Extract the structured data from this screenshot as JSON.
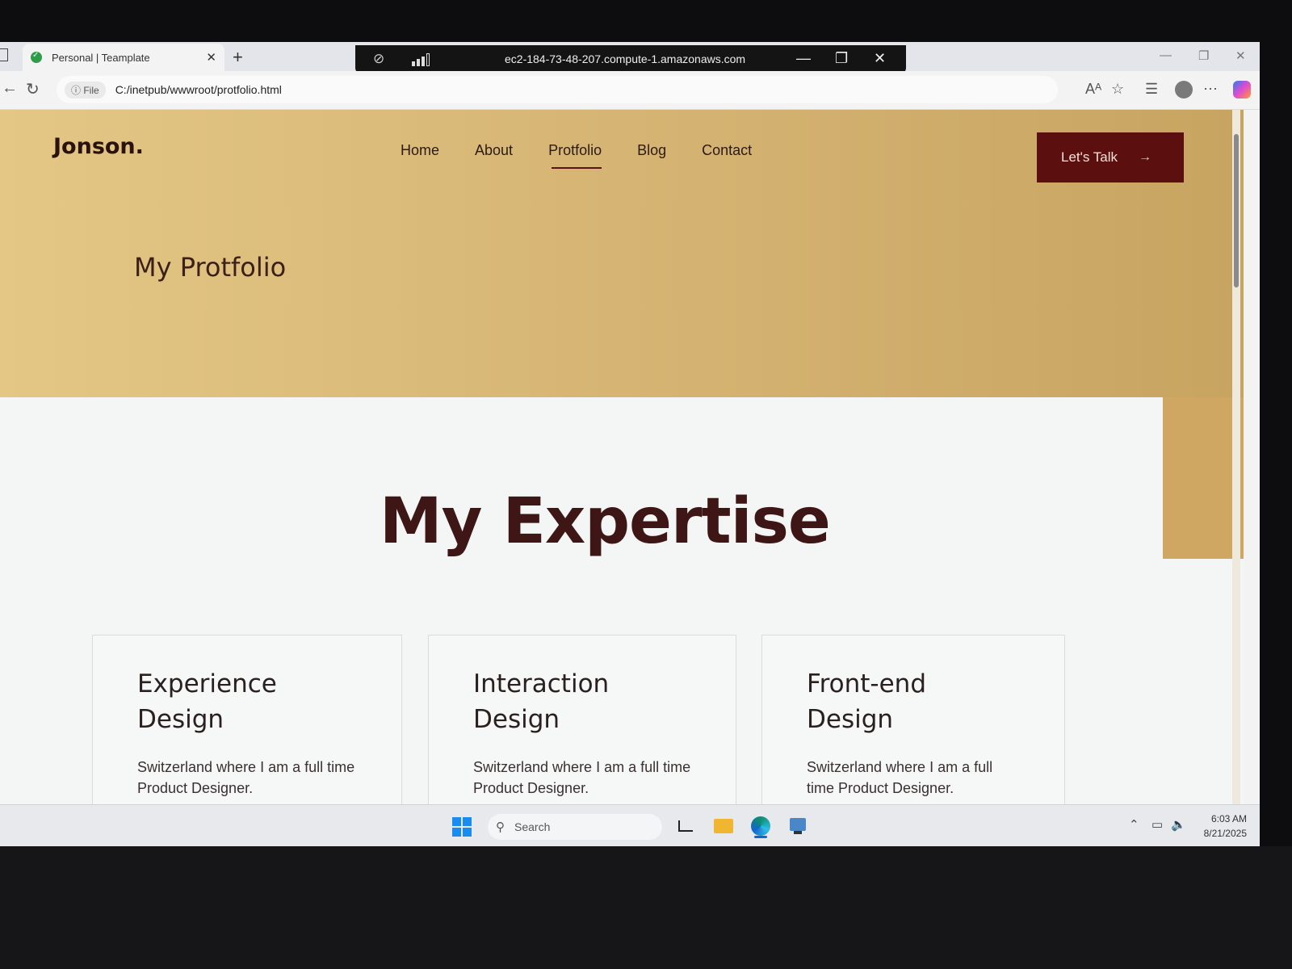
{
  "browser": {
    "tab_title": "Personal | Teamplate",
    "rdp_host": "ec2-184-73-48-207.compute-1.amazonaws.com",
    "url_scheme_label": "File",
    "url": "C:/inetpub/wwwroot/protfolio.html"
  },
  "site": {
    "logo": "Jonson.",
    "nav": [
      {
        "label": "Home"
      },
      {
        "label": "About"
      },
      {
        "label": "Protfolio",
        "active": true
      },
      {
        "label": "Blog"
      },
      {
        "label": "Contact"
      }
    ],
    "cta_label": "Let's Talk",
    "page_title": "My Protfolio",
    "section_title": "My Expertise",
    "cards": [
      {
        "title_line1": "Experience",
        "title_line2": "Design",
        "text": "Switzerland where I am a full time Product Designer."
      },
      {
        "title_line1": "Interaction",
        "title_line2": "Design",
        "text": "Switzerland where I am a full time Product Designer."
      },
      {
        "title_line1": "Front-end",
        "title_line2": "Design",
        "text": "Switzerland where I am a full time Product Designer."
      }
    ]
  },
  "taskbar": {
    "search_placeholder": "Search",
    "time": "6:03 AM",
    "date": "8/21/2025"
  },
  "colors": {
    "hero_gold": "#d3b170",
    "cta_maroon": "#5c0f0f",
    "heading_maroon": "#3f1616"
  }
}
